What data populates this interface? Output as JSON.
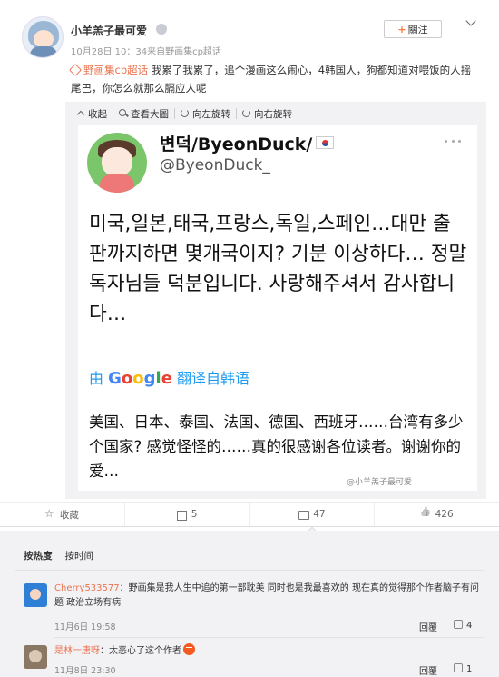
{
  "post": {
    "username": "小羊羔子最可爱",
    "meta": "10月28日 10：34来自野画集cp超话",
    "follow_label": "關注",
    "topic": "野画集cp超话",
    "text": "我累了我累了，追个漫画这么闹心，4韩国人，狗都知道对喂饭的人摇尾巴，你怎么就那么膈应人呢"
  },
  "image_toolbar": {
    "collapse": "收起",
    "view_large": "查看大圖",
    "rotate_left": "向左旋转",
    "rotate_right": "向右旋转"
  },
  "tweet": {
    "name": "변덕/ByeonDuck/",
    "handle": "@ByeonDuck_",
    "korean": "미국,일본,태국,프랑스,독일,스페인…대만 출판까지하면 몇개국이지? 기분 이상하다… 정말 독자님들 덕분입니다. 사랑해주셔서 감사합니다…",
    "translate_prefix": "由",
    "translate_suffix": "翻译自韩语",
    "chinese": "美国、日本、泰国、法国、德国、西班牙……台湾有多少个国家? 感觉怪怪的……真的很感谢各位读者。谢谢你的爱…"
  },
  "watermark": "@小羊羔子最可爱",
  "actions": {
    "favorite": "收藏",
    "share_count": "5",
    "comment_count": "47",
    "like_count": "426"
  },
  "comments_section": {
    "tabs": [
      "按热度",
      "按时间"
    ],
    "items": [
      {
        "user": "Cherry533577",
        "text": "：野画集是我人生中追的第一部耽美 同时也是我最喜欢的 现在真的觉得那个作者脑子有问题 政治立场有病",
        "time": "11月6日 19:58",
        "reply": "回覆",
        "likes": "4"
      },
      {
        "user": "是林一唐呀",
        "text": "：太恶心了这个作者",
        "time": "11月8日 23:30",
        "reply": "回覆",
        "likes": "1"
      }
    ]
  },
  "colors": {
    "accent": "#eb7350",
    "link_blue": "#1d9bf0",
    "panel_bg": "#f2f2f5"
  }
}
